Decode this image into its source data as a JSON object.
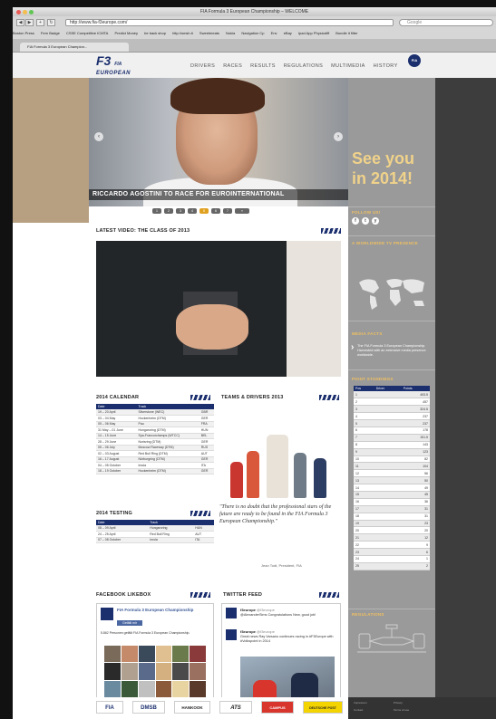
{
  "browser": {
    "window_title": "FIA Formula 3 European Championship – WELCOME",
    "url": "http://www.fia-f3europe.com/",
    "search_placeholder": "Google",
    "bookmarks": [
      "Boston Press",
      "Fern Badge",
      "CSSE Competitive ICMTA",
      "Predict Money",
      "be back shop",
      "http://smsh.ti",
      "Sweetmeats",
      "Nokia",
      "Navigation Cp",
      "Env",
      "eBay",
      "Ipad App Physiodiff",
      "Bundle it filter"
    ],
    "tab_label": "FIA Formula 3 European Champion..."
  },
  "header": {
    "logo_top": "F3",
    "logo_sub": "FIA",
    "logo_bottom": "EUROPEAN",
    "nav": [
      "DRIVERS",
      "RACES",
      "RESULTS",
      "REGULATIONS",
      "MULTIMEDIA",
      "HISTORY"
    ],
    "fia_badge": "FIA"
  },
  "hero": {
    "caption": "RICCARDO AGOSTINI TO RACE FOR EUROINTERNATIONAL",
    "prev": "‹",
    "next": "›",
    "pager": [
      "1",
      "2",
      "3",
      "4",
      "5",
      "6",
      "7"
    ],
    "pager_more": "»"
  },
  "video": {
    "title": "LATEST VIDEO: THE CLASS OF 2013"
  },
  "calendar": {
    "title": "2014 CALENDAR",
    "headers": [
      "Date",
      "Track",
      ""
    ],
    "rows": [
      [
        "19 – 20 April",
        "Silverstone (WEC)",
        "GBR"
      ],
      [
        "03 – 04 May",
        "Hockenheim (DTM)",
        "GER"
      ],
      [
        "05 – 06 May",
        "Pau",
        "FRA"
      ],
      [
        "31 May – 01 June",
        "Hungaroring (DTM)",
        "HUN"
      ],
      [
        "14 – 15 June",
        "Spa-Francorchamps (WTCC)",
        "BEL"
      ],
      [
        "28 – 29 June",
        "Norisring (DTM)",
        "GER"
      ],
      [
        "05 – 06 July",
        "Moscow Raceway (DTM)",
        "RUS"
      ],
      [
        "02 – 03 August",
        "Red Bull Ring (DTM)",
        "AUT"
      ],
      [
        "16 – 17 August",
        "Nürburgring (DTM)",
        "GER"
      ],
      [
        "04 – 05 October",
        "Imola",
        "ITA"
      ],
      [
        "18 – 19 October",
        "Hockenheim (DTM)",
        "GER"
      ]
    ]
  },
  "testing": {
    "title": "2014 TESTING",
    "headers": [
      "Date",
      "Track",
      ""
    ],
    "rows": [
      [
        "08 – 09 April",
        "Hungaroring",
        "HUN"
      ],
      [
        "24 – 25 April",
        "Red Bull Ring",
        "AUT"
      ],
      [
        "07 – 08 October",
        "Imola",
        "ITA"
      ]
    ]
  },
  "teams": {
    "title": "TEAMS & DRIVERS 2013",
    "quote": "\"There is no doubt that the professional stars of the future are ready to be found in the FIA Formula 3 European Championship.\"",
    "author": "Jean Todt, President, FIA"
  },
  "facebook": {
    "title": "FACEBOOK LIKEBOX",
    "page_name": "FIA Formula 3 European Championship",
    "like_button": "Gefällt mir",
    "likes_text": "5.862 Personen gefällt FIA Formula 3 European Championship."
  },
  "twitter": {
    "title": "TWITTER FEED",
    "tweets": [
      {
        "user": "f3europe",
        "handle": "@f3europe",
        "text": "@AlexanderSims Congratulations New, good job!"
      },
      {
        "user": "f3europe",
        "handle": "@f3europe",
        "text": "Great news Ray Varsano continues racing in #F3Europe with #Volkspoint in 2014"
      }
    ]
  },
  "sidebar": {
    "see_you_line1": "See you",
    "see_you_line2": "in 2014!",
    "follow_us": "FOLLOW US!",
    "social": [
      "f",
      "t",
      "y"
    ],
    "tv_title": "A WORLDWIDE TV PRESENCE",
    "media_title": "MEDIA FACTS",
    "media_text": "The FIA Formula 3 European Championship. Harvested with an extensive media presence worldwide.",
    "standings_title": "POINT STANDINGS",
    "standings_headers": [
      "Pos",
      "Driver",
      "Points"
    ],
    "standings": [
      [
        "1",
        "",
        "493.5"
      ],
      [
        "2",
        "",
        "457"
      ],
      [
        "3",
        "",
        "324.5"
      ],
      [
        "4",
        "",
        "237"
      ],
      [
        "5",
        "",
        "237"
      ],
      [
        "6",
        "",
        "178"
      ],
      [
        "7",
        "",
        "151.5"
      ],
      [
        "8",
        "",
        "143"
      ],
      [
        "9",
        "",
        "123"
      ],
      [
        "10",
        "",
        "82"
      ],
      [
        "11",
        "",
        "104"
      ],
      [
        "12",
        "",
        "56"
      ],
      [
        "13",
        "",
        "50"
      ],
      [
        "14",
        "",
        "49"
      ],
      [
        "15",
        "",
        "45"
      ],
      [
        "16",
        "",
        "36"
      ],
      [
        "17",
        "",
        "31"
      ],
      [
        "18",
        "",
        "31"
      ],
      [
        "19",
        "",
        "23"
      ],
      [
        "20",
        "",
        "20"
      ],
      [
        "21",
        "",
        "12"
      ],
      [
        "22",
        "",
        "9"
      ],
      [
        "23",
        "",
        "6"
      ],
      [
        "24",
        "",
        "1"
      ],
      [
        "25",
        "",
        "2"
      ]
    ],
    "regulations_title": "REGULATIONS"
  },
  "footer": {
    "sponsors": [
      "FIA",
      "DMSB",
      "HANKOOK",
      "ATS",
      "CAMPUS",
      "DEUTSCHE POST"
    ],
    "links_a": [
      "Impressum",
      "Contact"
    ],
    "links_b": [
      "Privacy",
      "Terms of use"
    ]
  },
  "colors": {
    "navy": "#1b2f6e",
    "accent": "#f0c060",
    "page_bg": "#4a4a4a"
  }
}
